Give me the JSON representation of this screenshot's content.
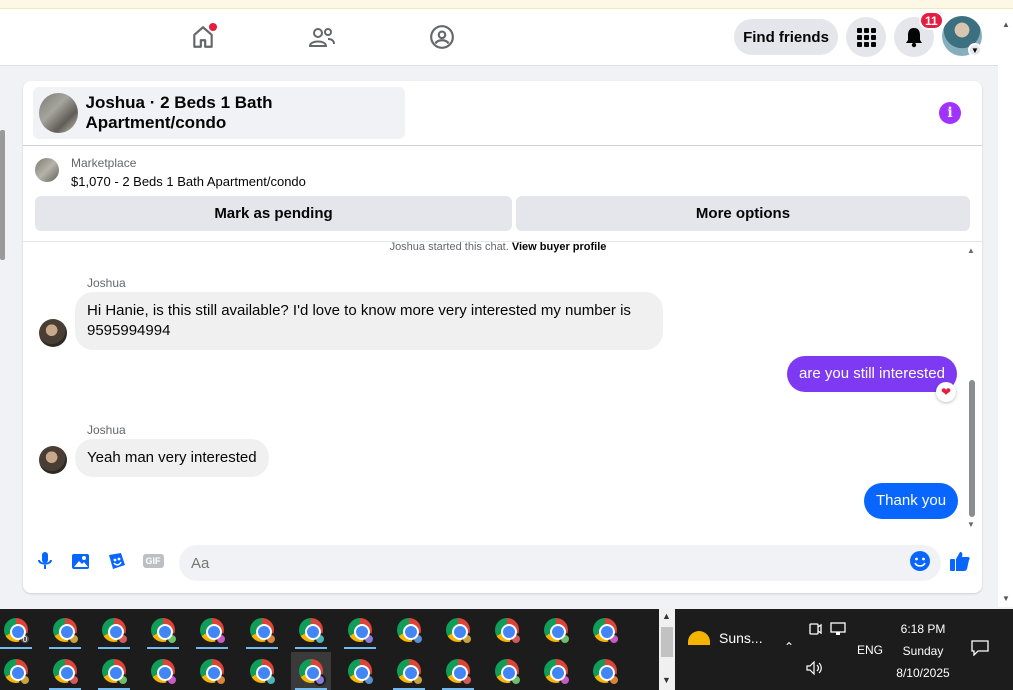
{
  "navbar": {
    "find_friends": "Find friends",
    "notification_count": "11"
  },
  "conversation": {
    "title": "Joshua · 2 Beds 1 Bath Apartment/condo",
    "marketplace_label": "Marketplace",
    "listing": "$1,070 - 2 Beds 1 Bath Apartment/condo",
    "mark_pending": "Mark as pending",
    "more_options": "More options",
    "started_text": "Joshua started this chat.",
    "view_profile": "View buyer profile"
  },
  "messages": [
    {
      "sender": "Joshua",
      "text": "Hi Hanie, is this still available? I'd love to know more very interested my number is 9595994994"
    },
    {
      "sender": "me",
      "text": "are you still interested",
      "reaction": "heart"
    },
    {
      "sender": "Joshua",
      "text": "Yeah man very interested"
    },
    {
      "sender": "me",
      "text": "Thank you"
    }
  ],
  "composer": {
    "placeholder": "Aa",
    "gif_label": "GIF"
  },
  "taskbar": {
    "weather": "Suns...",
    "language": "ENG",
    "time": "6:18 PM",
    "day": "Sunday",
    "date": "8/10/2025",
    "first_badge": "0"
  },
  "colors": {
    "accent": "#0866ff",
    "outgoing_bubble": "#7e3af2",
    "info": "#a033ff",
    "notification": "#e41e3f"
  }
}
